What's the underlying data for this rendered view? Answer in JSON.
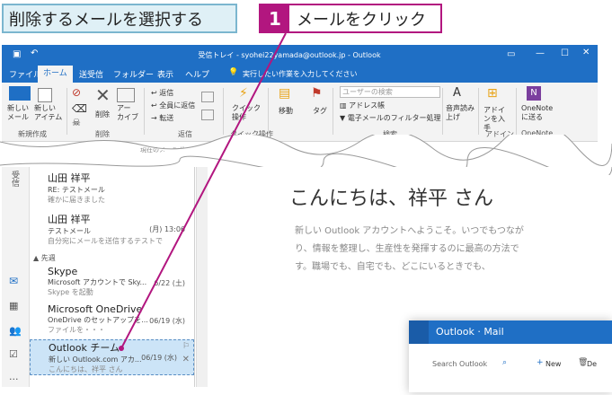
{
  "captions": {
    "left": "削除するメールを選択する",
    "step_number": "1",
    "step_text": "メールをクリック"
  },
  "window": {
    "title": "受信トレイ - syohei22yamada@outlook.jp - Outlook",
    "tabs": [
      "ファイル",
      "ホーム",
      "送受信",
      "フォルダー",
      "表示",
      "ヘルプ"
    ],
    "active_tab": "ホーム",
    "tell_me": "実行したい作業を入力してください"
  },
  "ribbon": {
    "new_mail": "新しい\nメール",
    "new_items": "新しい\nアイテム",
    "delete": "削除",
    "archive": "アー\nカイブ",
    "reply": "返信",
    "reply_all": "全員に返信",
    "forward": "転送",
    "quick_steps": "クイック\n操作",
    "move": "移動",
    "tags": "タグ",
    "search_people": "ユーザーの検索",
    "address_book": "アドレス帳",
    "filter_email": "電子メールのフィルター処理",
    "read_aloud": "音声読み\n上げ",
    "get_addins": "アドインを入手",
    "onenote": "OneNote\nに送る",
    "groups": {
      "new": "新規作成",
      "delete": "削除",
      "respond": "返信",
      "quick_steps": "クイック操作",
      "find": "検索",
      "addins": "アドイン",
      "onenote": "OneNote"
    },
    "search_placeholder": "現在のメールボックス"
  },
  "mail_list": {
    "items": [
      {
        "from": "山田 祥平",
        "subject": "RE: テストメール",
        "preview": "確かに届きました",
        "date": ""
      },
      {
        "from": "山田 祥平",
        "subject": "テストメール",
        "preview": "自分宛にメールを送信するテストで",
        "date": "(月) 13:06"
      },
      {
        "from": "Skype",
        "subject": "Microsoft アカウントで Sky...",
        "preview": "Skype を起動",
        "date": "6/22 (土)"
      },
      {
        "from": "Microsoft OneDrive",
        "subject": "OneDrive のセットアップを...",
        "preview": "ファイルを・・・",
        "date": "06/19 (水)"
      },
      {
        "from": "Outlook チーム",
        "subject": "新しい Outlook.com アカ...",
        "preview": "こんにちは、祥平 さん",
        "date": "06/19 (水)"
      }
    ],
    "section_header": "先週"
  },
  "reading": {
    "greeting": "こんにちは、祥平 さん",
    "body": "新しい Outlook アカウントへようこそ。いつでもつながり、情報を整理し、生産性を発揮するのに最高の方法です。職場でも、自宅でも、どこにいるときでも、",
    "card_title": "Outlook · Mail",
    "card_search": "Search Outlook",
    "card_new": "New",
    "card_delete": "De"
  },
  "colors": {
    "outlook_blue": "#1f6fc5",
    "step_magenta": "#b2167f",
    "caption_bg": "#dff0f6"
  }
}
